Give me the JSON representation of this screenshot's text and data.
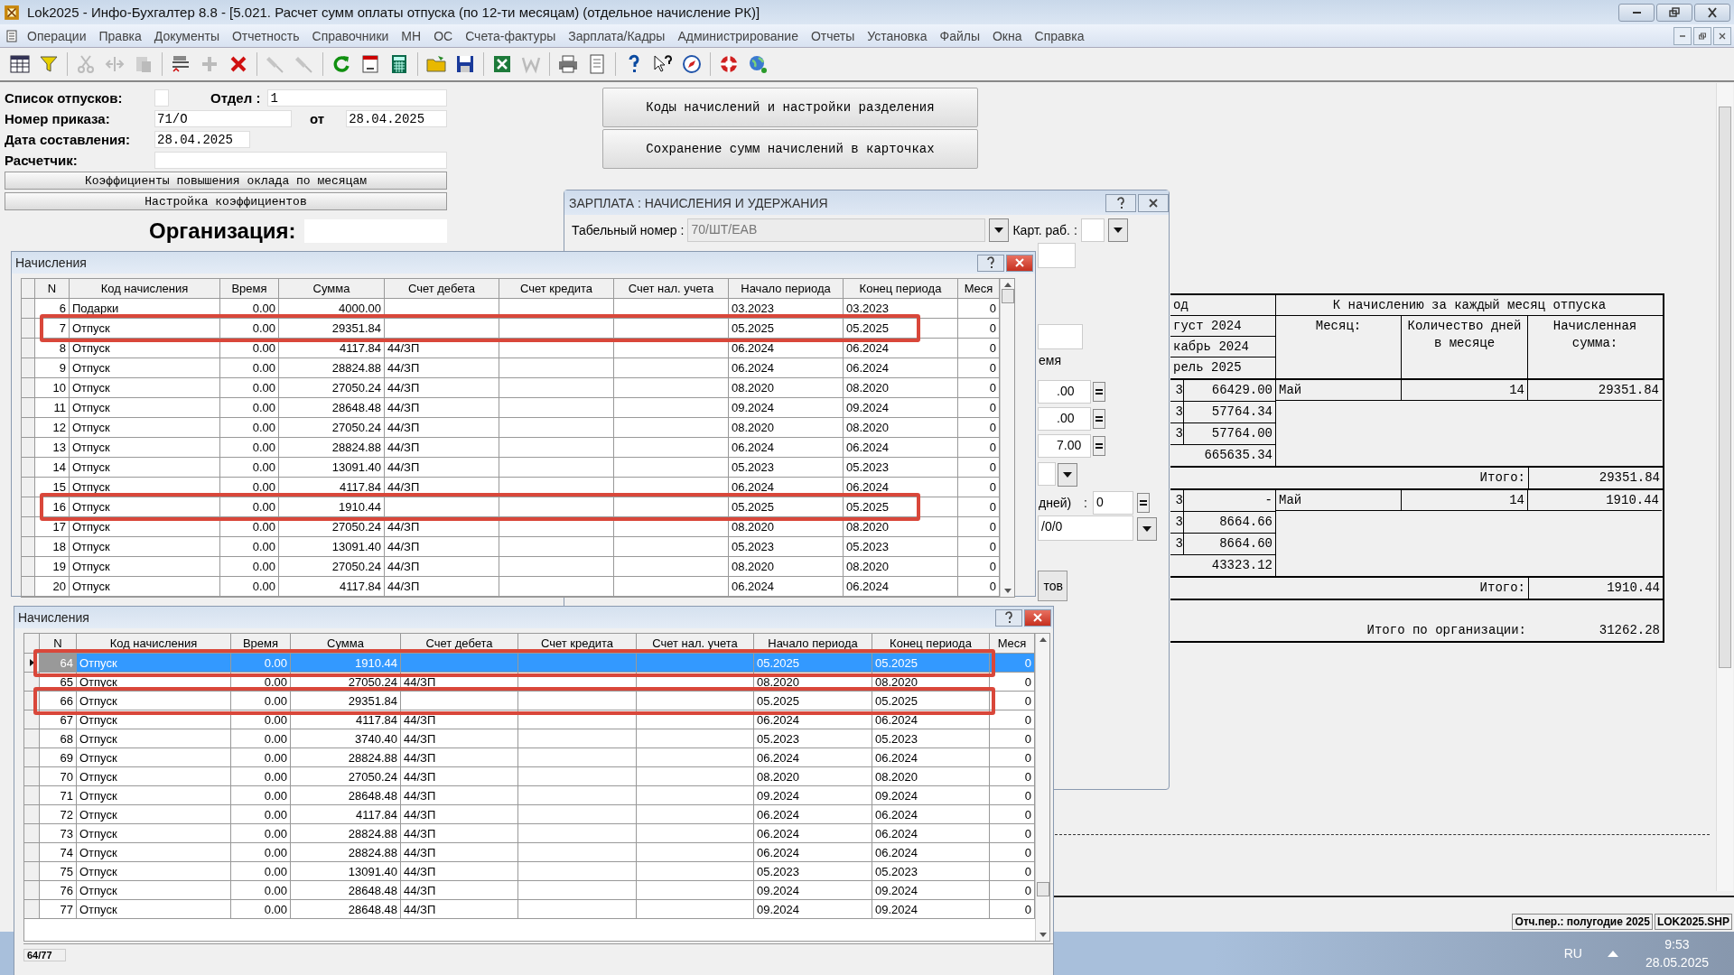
{
  "window": {
    "title": "Lok2025 - Инфо-Бухгалтер 8.8 - [5.021. Расчет сумм оплаты отпуска (по 12-ти месяцам) (отдельное начисление РК)]"
  },
  "menu": [
    "Операции",
    "Правка",
    "Документы",
    "Отчетность",
    "Справочники",
    "МН",
    "ОС",
    "Счета-фактуры",
    "Зарплата/Кадры",
    "Администрирование",
    "Отчеты",
    "Установка",
    "Файлы",
    "Окна",
    "Справка"
  ],
  "form": {
    "list_label": "Список отпусков:",
    "dept_label": "Отдел :",
    "dept": "1",
    "order_label": "Номер приказа:",
    "order": "71/О",
    "from_label": "от",
    "order_date": "28.04.2025",
    "date_label": "Дата составления:",
    "date": "28.04.2025",
    "payroll_label": "Расчетчик:",
    "buttons": [
      "Коэффициенты повышения оклада по месяцам",
      "Настройка коэффициентов"
    ],
    "org_label": "Организация:"
  },
  "action_buttons": [
    "Коды начислений и настройки разделения",
    "Сохранение сумм начислений в карточках"
  ],
  "dialog": {
    "title": "ЗАРПЛАТА : НАЧИСЛЕНИЯ И УДЕРЖАНИЯ",
    "tab_number_label": "Табельный номер",
    "tab_number_colon": ":",
    "tab_number": "70/ШТ/ЕАВ",
    "card_label": "Карт. раб.",
    "card_colon": ":",
    "time_label": "емя",
    "values": [
      ".00",
      ".00",
      "7.00"
    ],
    "days_label": "дней)",
    "days_colon": ":",
    "days": "0",
    "code": "/0/0",
    "button": "тов"
  },
  "report": {
    "corner": "од",
    "header": "К начислению за каждый месяц отпуска",
    "periods": [
      "густ 2024",
      "кабрь 2024",
      "рель 2025"
    ],
    "columns": [
      "Месяц:",
      "Количество дней в месяце",
      "Начисленная сумма:"
    ],
    "groups": [
      {
        "lines": [
          {
            "mark": "3",
            "amount": "66429.00"
          },
          {
            "mark": "3",
            "amount": "57764.34"
          },
          {
            "mark": "3",
            "amount": "57764.00"
          },
          {
            "amount": "665635.34"
          }
        ],
        "month": "Май",
        "days": "14",
        "sum": "29351.84",
        "total_label": "Итого:",
        "total": "29351.84"
      },
      {
        "lines": [
          {
            "mark": "3",
            "amount": "-"
          },
          {
            "mark": "3",
            "amount": "8664.66"
          },
          {
            "mark": "3",
            "amount": "8664.60"
          },
          {
            "amount": "43323.12"
          }
        ],
        "month": "Май",
        "days": "14",
        "sum": "1910.44",
        "total_label": "Итого:",
        "total": "1910.44"
      }
    ],
    "grand_label": "Итого по организации:",
    "grand_total": "31262.28"
  },
  "grids": [
    {
      "title": "Начисления",
      "columns": [
        "N",
        "Код начисления",
        "Время",
        "Сумма",
        "Счет дебета",
        "Счет кредита",
        "Счет нал. учета",
        "Начало периода",
        "Конец периода",
        "Меся"
      ],
      "rows": [
        {
          "n": "6",
          "code": "Подарки",
          "time": "0.00",
          "sum": "4000.00",
          "start": "03.2023",
          "end": "03.2023",
          "months": "0",
          "marked": false,
          "selected": false
        },
        {
          "n": "7",
          "code": "Отпуск",
          "time": "0.00",
          "sum": "29351.84",
          "start": "05.2025",
          "end": "05.2025",
          "months": "0",
          "marked": true,
          "selected": false
        },
        {
          "n": "8",
          "code": "Отпуск",
          "time": "0.00",
          "sum": "4117.84",
          "debit": "44/ЗП",
          "start": "06.2024",
          "end": "06.2024",
          "months": "0",
          "marked": false,
          "selected": false
        },
        {
          "n": "9",
          "code": "Отпуск",
          "time": "0.00",
          "sum": "28824.88",
          "debit": "44/ЗП",
          "start": "06.2024",
          "end": "06.2024",
          "months": "0",
          "marked": false,
          "selected": false
        },
        {
          "n": "10",
          "code": "Отпуск",
          "time": "0.00",
          "sum": "27050.24",
          "debit": "44/ЗП",
          "start": "08.2020",
          "end": "08.2020",
          "months": "0",
          "marked": false,
          "selected": false
        },
        {
          "n": "11",
          "code": "Отпуск",
          "time": "0.00",
          "sum": "28648.48",
          "debit": "44/ЗП",
          "start": "09.2024",
          "end": "09.2024",
          "months": "0",
          "marked": false,
          "selected": false
        },
        {
          "n": "12",
          "code": "Отпуск",
          "time": "0.00",
          "sum": "27050.24",
          "debit": "44/ЗП",
          "start": "08.2020",
          "end": "08.2020",
          "months": "0",
          "marked": false,
          "selected": false
        },
        {
          "n": "13",
          "code": "Отпуск",
          "time": "0.00",
          "sum": "28824.88",
          "debit": "44/ЗП",
          "start": "06.2024",
          "end": "06.2024",
          "months": "0",
          "marked": false,
          "selected": false
        },
        {
          "n": "14",
          "code": "Отпуск",
          "time": "0.00",
          "sum": "13091.40",
          "debit": "44/ЗП",
          "start": "05.2023",
          "end": "05.2023",
          "months": "0",
          "marked": false,
          "selected": false
        },
        {
          "n": "15",
          "code": "Отпуск",
          "time": "0.00",
          "sum": "4117.84",
          "debit": "44/ЗП",
          "start": "06.2024",
          "end": "06.2024",
          "months": "0",
          "marked": false,
          "selected": false
        },
        {
          "n": "16",
          "code": "Отпуск",
          "time": "0.00",
          "sum": "1910.44",
          "start": "05.2025",
          "end": "05.2025",
          "months": "0",
          "marked": true,
          "selected": false
        },
        {
          "n": "17",
          "code": "Отпуск",
          "time": "0.00",
          "sum": "27050.24",
          "debit": "44/ЗП",
          "start": "08.2020",
          "end": "08.2020",
          "months": "0",
          "marked": false,
          "selected": false
        },
        {
          "n": "18",
          "code": "Отпуск",
          "time": "0.00",
          "sum": "13091.40",
          "debit": "44/ЗП",
          "start": "05.2023",
          "end": "05.2023",
          "months": "0",
          "marked": false,
          "selected": false
        },
        {
          "n": "19",
          "code": "Отпуск",
          "time": "0.00",
          "sum": "27050.24",
          "debit": "44/ЗП",
          "start": "08.2020",
          "end": "08.2020",
          "months": "0",
          "marked": false,
          "selected": false
        },
        {
          "n": "20",
          "code": "Отпуск",
          "time": "0.00",
          "sum": "4117.84",
          "debit": "44/ЗП",
          "start": "06.2024",
          "end": "06.2024",
          "months": "0",
          "marked": false,
          "selected": false
        }
      ]
    },
    {
      "title": "Начисления",
      "columns": [
        "N",
        "Код начисления",
        "Время",
        "Сумма",
        "Счет дебета",
        "Счет кредита",
        "Счет нал. учета",
        "Начало периода",
        "Конец периода",
        "Меся"
      ],
      "footer": "64/77",
      "rows": [
        {
          "n": "64",
          "code": "Отпуск",
          "time": "0.00",
          "sum": "1910.44",
          "start": "05.2025",
          "end": "05.2025",
          "months": "0",
          "marked": true,
          "selected": true
        },
        {
          "n": "65",
          "code": "Отпуск",
          "time": "0.00",
          "sum": "27050.24",
          "debit": "44/ЗП",
          "start": "08.2020",
          "end": "08.2020",
          "months": "0",
          "marked": false,
          "selected": false
        },
        {
          "n": "66",
          "code": "Отпуск",
          "time": "0.00",
          "sum": "29351.84",
          "start": "05.2025",
          "end": "05.2025",
          "months": "0",
          "marked": true,
          "selected": false
        },
        {
          "n": "67",
          "code": "Отпуск",
          "time": "0.00",
          "sum": "4117.84",
          "debit": "44/ЗП",
          "start": "06.2024",
          "end": "06.2024",
          "months": "0",
          "marked": false,
          "selected": false
        },
        {
          "n": "68",
          "code": "Отпуск",
          "time": "0.00",
          "sum": "3740.40",
          "debit": "44/ЗП",
          "start": "05.2023",
          "end": "05.2023",
          "months": "0",
          "marked": false,
          "selected": false
        },
        {
          "n": "69",
          "code": "Отпуск",
          "time": "0.00",
          "sum": "28824.88",
          "debit": "44/ЗП",
          "start": "06.2024",
          "end": "06.2024",
          "months": "0",
          "marked": false,
          "selected": false
        },
        {
          "n": "70",
          "code": "Отпуск",
          "time": "0.00",
          "sum": "27050.24",
          "debit": "44/ЗП",
          "start": "08.2020",
          "end": "08.2020",
          "months": "0",
          "marked": false,
          "selected": false
        },
        {
          "n": "71",
          "code": "Отпуск",
          "time": "0.00",
          "sum": "28648.48",
          "debit": "44/ЗП",
          "start": "09.2024",
          "end": "09.2024",
          "months": "0",
          "marked": false,
          "selected": false
        },
        {
          "n": "72",
          "code": "Отпуск",
          "time": "0.00",
          "sum": "4117.84",
          "debit": "44/ЗП",
          "start": "06.2024",
          "end": "06.2024",
          "months": "0",
          "marked": false,
          "selected": false
        },
        {
          "n": "73",
          "code": "Отпуск",
          "time": "0.00",
          "sum": "28824.88",
          "debit": "44/ЗП",
          "start": "06.2024",
          "end": "06.2024",
          "months": "0",
          "marked": false,
          "selected": false
        },
        {
          "n": "74",
          "code": "Отпуск",
          "time": "0.00",
          "sum": "28824.88",
          "debit": "44/ЗП",
          "start": "06.2024",
          "end": "06.2024",
          "months": "0",
          "marked": false,
          "selected": false
        },
        {
          "n": "75",
          "code": "Отпуск",
          "time": "0.00",
          "sum": "13091.40",
          "debit": "44/ЗП",
          "start": "05.2023",
          "end": "05.2023",
          "months": "0",
          "marked": false,
          "selected": false
        },
        {
          "n": "76",
          "code": "Отпуск",
          "time": "0.00",
          "sum": "28648.48",
          "debit": "44/ЗП",
          "start": "09.2024",
          "end": "09.2024",
          "months": "0",
          "marked": false,
          "selected": false
        },
        {
          "n": "77",
          "code": "Отпуск",
          "time": "0.00",
          "sum": "28648.48",
          "debit": "44/ЗП",
          "start": "09.2024",
          "end": "09.2024",
          "months": "0",
          "marked": false,
          "selected": false
        }
      ]
    }
  ],
  "status_bar": [
    "Отч.пер.: полугодие 2025",
    "LOK2025.SHP"
  ],
  "taskbar": {
    "language": "RU",
    "time": "9:53",
    "date": "28.05.2025"
  }
}
